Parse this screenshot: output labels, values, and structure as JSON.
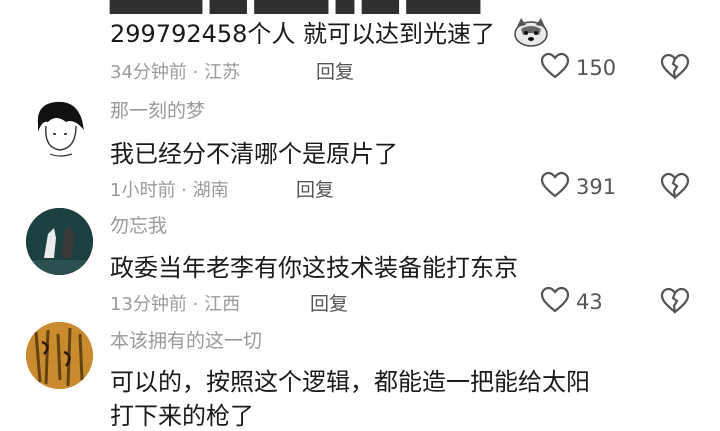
{
  "comments": [
    {
      "text_partial": "299792458个人 就可以达到光速了",
      "time": "34分钟前",
      "location": "江苏",
      "reply_label": "回复",
      "likes": "150"
    },
    {
      "username": "那一刻的梦",
      "text": "我已经分不清哪个是原片了",
      "time": "1小时前",
      "location": "湖南",
      "reply_label": "回复",
      "likes": "391"
    },
    {
      "username": "勿忘我",
      "text": "政委当年老李有你这技术装备能打东京",
      "time": "13分钟前",
      "location": "江西",
      "reply_label": "回复",
      "likes": "43"
    },
    {
      "username": "本该拥有的这一切",
      "text": "可以的，按照这个逻辑，都能造一把能给太阳",
      "text_line2_partial": "打下来的枪了"
    }
  ],
  "separator": " · ",
  "colors": {
    "secondary_text": "#9a9a9a",
    "primary_text": "#1a1a1a",
    "icon": "#555555"
  },
  "icons": {
    "like": "heart-outline-icon",
    "dislike": "broken-heart-icon",
    "sticker": "husky-dog-emoji"
  }
}
